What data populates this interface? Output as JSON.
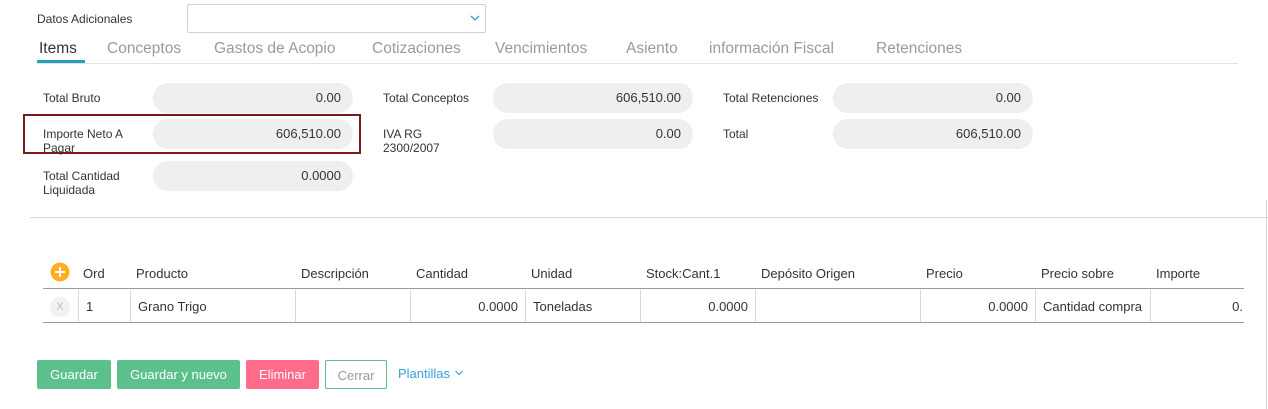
{
  "additional": {
    "label": "Datos Adicionales",
    "value": ""
  },
  "tabs": [
    {
      "label": "Items",
      "active": true
    },
    {
      "label": "Conceptos"
    },
    {
      "label": "Gastos de Acopio"
    },
    {
      "label": "Cotizaciones"
    },
    {
      "label": "Vencimientos"
    },
    {
      "label": "Asiento"
    },
    {
      "label": "información Fiscal"
    },
    {
      "label": "Retenciones"
    }
  ],
  "totals": {
    "total_bruto": {
      "label": "Total Bruto",
      "value": "0.00"
    },
    "importe_neto": {
      "label": "Importe Neto A Pagar",
      "value": "606,510.00"
    },
    "total_cantidad": {
      "label": "Total Cantidad Liquidada",
      "value": "0.0000"
    },
    "total_conceptos": {
      "label": "Total Conceptos",
      "value": "606,510.00"
    },
    "iva_rg": {
      "label": "IVA RG 2300/2007",
      "value": "0.00"
    },
    "total_retenciones": {
      "label": "Total Retenciones",
      "value": "0.00"
    },
    "total": {
      "label": "Total",
      "value": "606,510.00"
    }
  },
  "table": {
    "headers": [
      "Ord",
      "Producto",
      "Descripción",
      "Cantidad",
      "Unidad",
      "Stock:Cant.1",
      "Depósito Origen",
      "Precio",
      "Precio sobre",
      "Importe"
    ],
    "rows": [
      {
        "remove": "X",
        "ord": "1",
        "producto": "Grano Trigo",
        "descripcion": "",
        "cantidad": "0.0000",
        "unidad": "Toneladas",
        "stock": "0.0000",
        "deposito": "",
        "precio": "0.0000",
        "precio_sobre": "Cantidad compra",
        "importe": "0."
      }
    ]
  },
  "buttons": {
    "guardar": "Guardar",
    "guardar_nuevo": "Guardar y nuevo",
    "eliminar": "Eliminar",
    "cerrar": "Cerrar",
    "plantillas": "Plantillas"
  },
  "icons": {
    "add": "plus-circle-icon",
    "dropdown": "chevron-down-icon"
  },
  "colors": {
    "green": "#5cc08c",
    "red": "#ff6b8a",
    "link": "#3a9fd8",
    "highlight": "#7a1a1a",
    "tab_active_underline": "#22a3b8",
    "add_icon": "#ffb020"
  }
}
